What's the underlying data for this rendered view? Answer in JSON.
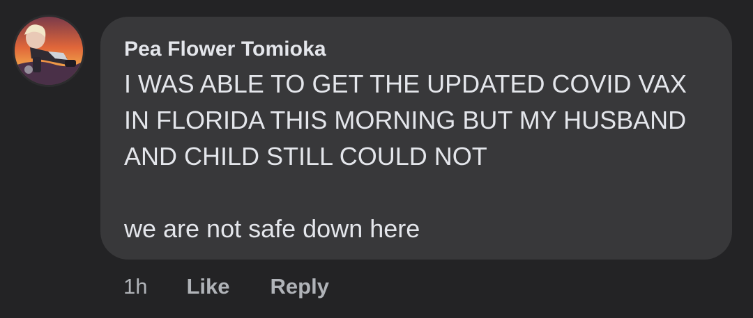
{
  "comment": {
    "author": "Pea Flower Tomioka",
    "lines": [
      "I WAS ABLE TO GET THE UPDATED COVID VAX",
      "IN FLORIDA THIS MORNING BUT MY HUSBAND",
      "AND CHILD STILL COULD NOT",
      "we are not safe down here"
    ],
    "timestamp": "1h",
    "like_label": "Like",
    "reply_label": "Reply"
  },
  "colors": {
    "background": "#232325",
    "bubble": "#38383a",
    "primary_text": "#e4e6eb",
    "secondary_text": "#b0b3b8"
  },
  "icons": {
    "avatar": "avatar-illustration"
  }
}
